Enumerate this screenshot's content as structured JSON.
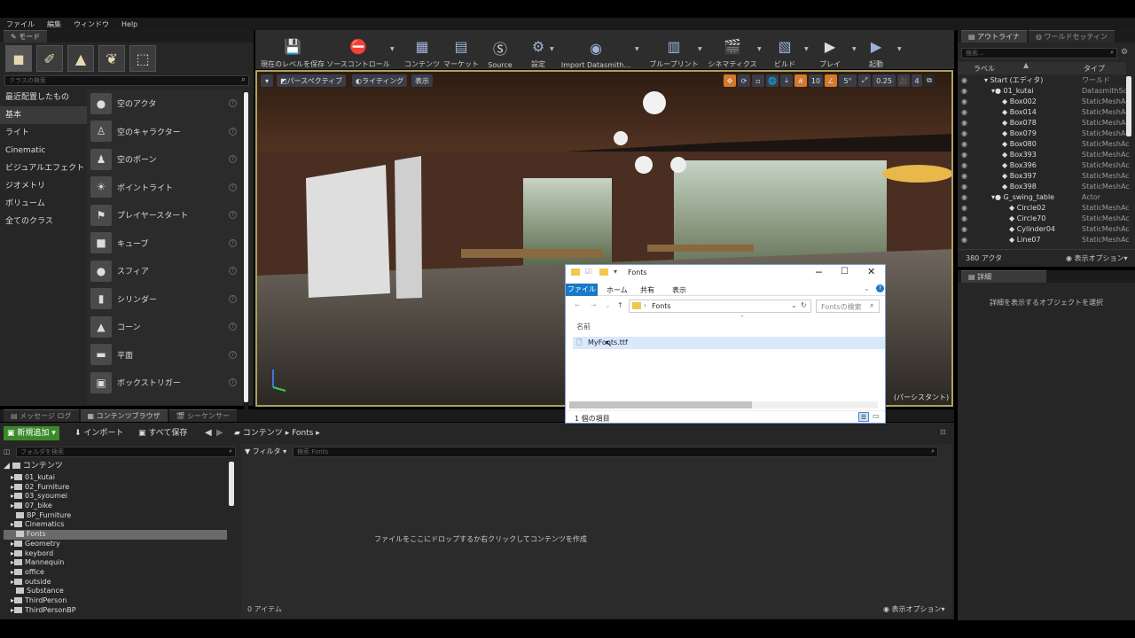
{
  "menu": [
    "ファイル",
    "編集",
    "ウィンドウ",
    "Help"
  ],
  "modes": {
    "title": "モード",
    "search_placeholder": "クラスの検索",
    "categories": [
      "最近配置したもの",
      "基本",
      "ライト",
      "Cinematic",
      "ビジュアルエフェクト",
      "ジオメトリ",
      "ボリューム",
      "全てのクラス"
    ],
    "items": [
      "空のアクタ",
      "空のキャラクター",
      "空のポーン",
      "ポイントライト",
      "プレイヤースタート",
      "キューブ",
      "スフィア",
      "シリンダー",
      "コーン",
      "平面",
      "ボックストリガー"
    ]
  },
  "toolbar": {
    "buttons": [
      "現在のレベルを保存",
      "ソースコントロール",
      "コンテンツ",
      "マーケット",
      "Source",
      "設定",
      "Import Datasmith...",
      "ブループリント",
      "シネマティクス",
      "ビルド",
      "プレイ",
      "起動"
    ]
  },
  "viewport": {
    "perspective": "パースペクティブ",
    "lighting": "ライティング",
    "show": "表示",
    "snap_value": "10",
    "angle_value": "5°",
    "scale_value": "0.25",
    "camera_speed": "4",
    "overlay_text": "(パーシスタント)"
  },
  "outliner": {
    "tab": "アウトライナ",
    "world_tab": "ワールドセッティン",
    "search_placeholder": "検索...",
    "col_label": "ラベル",
    "col_type": "タイプ",
    "rows": [
      {
        "name": "Start (エディタ)",
        "type": "ワールド"
      },
      {
        "name": "01_kutai",
        "type": "DatasmithSce"
      },
      {
        "name": "Box002",
        "type": "StaticMeshAc"
      },
      {
        "name": "Box014",
        "type": "StaticMeshAc"
      },
      {
        "name": "Box078",
        "type": "StaticMeshAc"
      },
      {
        "name": "Box079",
        "type": "StaticMeshAc"
      },
      {
        "name": "Box080",
        "type": "StaticMeshAc"
      },
      {
        "name": "Box393",
        "type": "StaticMeshAc"
      },
      {
        "name": "Box396",
        "type": "StaticMeshAc"
      },
      {
        "name": "Box397",
        "type": "StaticMeshAc"
      },
      {
        "name": "Box398",
        "type": "StaticMeshAc"
      },
      {
        "name": "G_swing_table",
        "type": "Actor"
      },
      {
        "name": "Circle02",
        "type": "StaticMeshAc"
      },
      {
        "name": "Circle70",
        "type": "StaticMeshAc"
      },
      {
        "name": "Cylinder04",
        "type": "StaticMeshAc"
      },
      {
        "name": "Line07",
        "type": "StaticMeshAc"
      }
    ],
    "count": "380 アクタ",
    "view_options": "表示オプション"
  },
  "details": {
    "tab": "詳細",
    "message": "詳細を表示するオブジェクトを選択"
  },
  "bottom_tabs": [
    "メッセージ ログ",
    "コンテンツブラウザ",
    "シーケンサー"
  ],
  "content_browser": {
    "add_new": "新規追加",
    "import": "インポート",
    "save_all": "すべて保存",
    "path_root": "コンテンツ",
    "path_leaf": "Fonts",
    "folder_search_placeholder": "フォルダを検索",
    "filter": "フィルタ",
    "search_placeholder": "検索 Fonts",
    "tree_root": "コンテンツ",
    "folders": [
      "01_kutai",
      "02_Furniture",
      "03_syoumei",
      "07_bike",
      "BP_Furniture",
      "Cinematics",
      "Fonts",
      "Geometry",
      "keybord",
      "Mannequin",
      "office",
      "outside",
      "Substance",
      "ThirdPerson",
      "ThirdPersonBP"
    ],
    "selected_folder": "Fonts",
    "empty_hint": "ファイルをここにドロップするか右クリックしてコンテンツを作成",
    "item_count": "0 アイテム",
    "view_options": "表示オプション"
  },
  "explorer": {
    "title": "Fonts",
    "ribbon_tabs": [
      "ファイル",
      "ホーム",
      "共有",
      "表示"
    ],
    "address": "Fonts",
    "search_placeholder": "Fontsの検索",
    "col_name": "名前",
    "file": "MyFonts.ttf",
    "status": "1 個の項目"
  }
}
